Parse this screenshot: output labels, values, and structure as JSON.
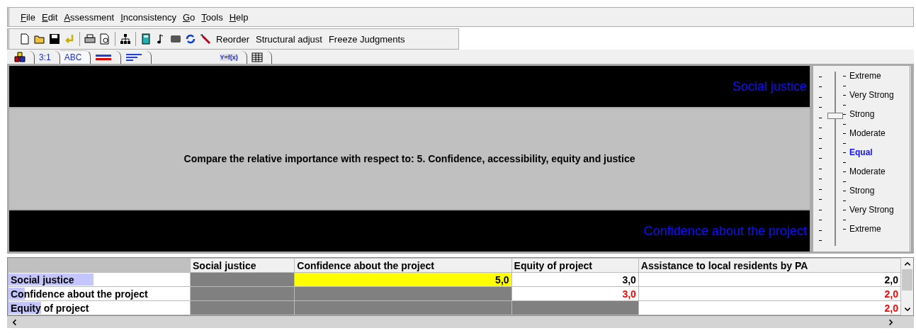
{
  "menu": [
    "File",
    "Edit",
    "Assessment",
    "Inconsistency",
    "Go",
    "Tools",
    "Help"
  ],
  "toolbar": {
    "icons": [
      {
        "kind": "new"
      },
      {
        "kind": "open"
      },
      {
        "kind": "save"
      },
      {
        "kind": "undo"
      },
      {
        "kind": "separator"
      },
      {
        "kind": "print"
      },
      {
        "kind": "preview"
      },
      {
        "kind": "separator"
      },
      {
        "kind": "hierarchy"
      },
      {
        "kind": "separator"
      },
      {
        "kind": "calculator"
      },
      {
        "kind": "note"
      },
      {
        "kind": "panel"
      },
      {
        "kind": "refresh"
      },
      {
        "kind": "wand"
      }
    ],
    "buttons": [
      "Reorder",
      "Structural adjust",
      "Freeze Judgments"
    ]
  },
  "tabs": [
    {
      "kind": "cubes",
      "selected": false
    },
    {
      "kind": "text",
      "label": "3:1",
      "selected": false
    },
    {
      "kind": "text",
      "label": "ABC",
      "selected": true
    },
    {
      "kind": "bars",
      "selected": false
    },
    {
      "kind": "lines",
      "selected": false
    },
    {
      "kind": "formula",
      "label": "Y=f(x)",
      "selected": false
    },
    {
      "kind": "grid",
      "selected": false
    }
  ],
  "comparison": {
    "top_element": "Social justice",
    "prompt": "Compare the relative importance  with respect to: 5. Confidence, accessibility, equity and justice",
    "bottom_element": "Confidence about the project"
  },
  "scale": {
    "level": 0.75,
    "labels": [
      {
        "label": "Extreme",
        "selected": false
      },
      {
        "label": "Very Strong",
        "selected": false
      },
      {
        "label": "Strong",
        "selected": false
      },
      {
        "label": "Moderate",
        "selected": false
      },
      {
        "label": "Equal",
        "selected": true
      },
      {
        "label": "Moderate",
        "selected": false
      },
      {
        "label": "Strong",
        "selected": false
      },
      {
        "label": "Very Strong",
        "selected": false
      },
      {
        "label": "Extreme",
        "selected": false
      }
    ]
  },
  "table": {
    "columns": [
      "Social justice",
      "Confidence about the project",
      "Equity of project",
      "Assistance to local residents by PA"
    ],
    "rows": [
      {
        "label": "Social justice",
        "level": 0.47,
        "cells": [
          {
            "kind": "blank"
          },
          {
            "kind": "value",
            "value": "5,0",
            "selected": true,
            "flagged": false
          },
          {
            "kind": "value",
            "value": "3,0",
            "selected": false,
            "flagged": false
          },
          {
            "kind": "value",
            "value": "2,0",
            "selected": false,
            "flagged": false
          }
        ]
      },
      {
        "label": "Confidence about the project",
        "level": 0.09,
        "cells": [
          {
            "kind": "blank"
          },
          {
            "kind": "blank"
          },
          {
            "kind": "value",
            "value": "3,0",
            "selected": false,
            "flagged": true
          },
          {
            "kind": "value",
            "value": "2,0",
            "selected": false,
            "flagged": true
          }
        ]
      },
      {
        "label": "Equity of project",
        "level": 0.18,
        "cells": [
          {
            "kind": "blank"
          },
          {
            "kind": "blank"
          },
          {
            "kind": "blank"
          },
          {
            "kind": "value",
            "value": "2,0",
            "selected": false,
            "flagged": true
          }
        ]
      }
    ]
  }
}
